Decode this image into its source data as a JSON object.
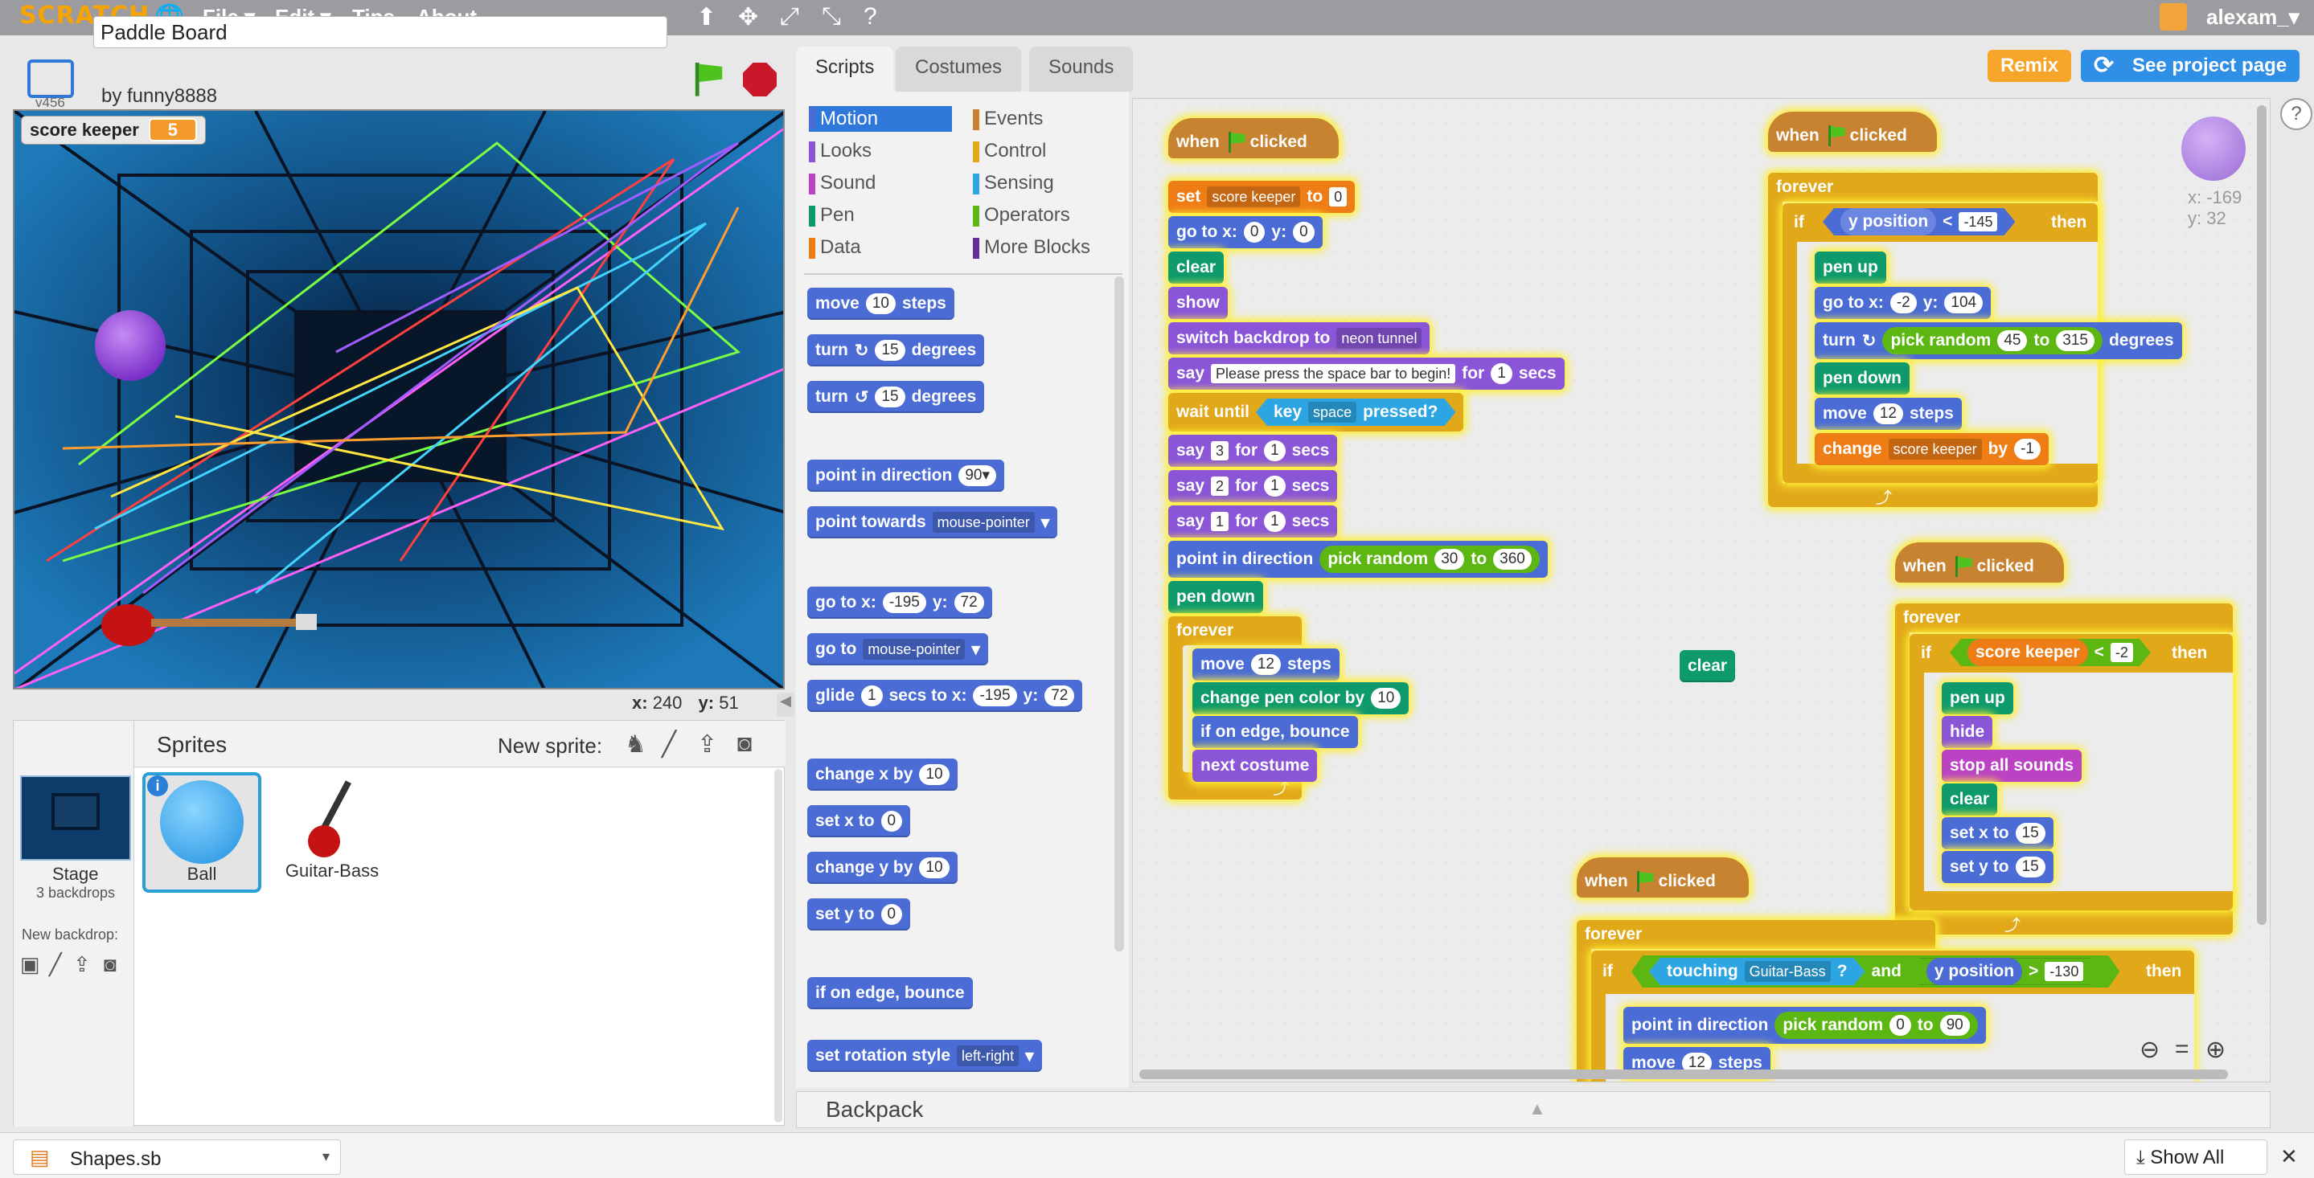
{
  "menu": {
    "logo": "SCRATCH",
    "file": "File ▾",
    "edit": "Edit ▾",
    "tips": "Tips",
    "about": "About",
    "user": "alexam_▾",
    "version": "v456"
  },
  "project": {
    "title": "Paddle Board",
    "author": "by funny8888"
  },
  "stage": {
    "monitor_label": "score keeper",
    "monitor_value": "5",
    "x_label": "x:",
    "x_value": "240",
    "y_label": "y:",
    "y_value": "51"
  },
  "sprites": {
    "heading": "Sprites",
    "new_sprite": "New sprite:",
    "stage_label": "Stage",
    "backdrops": "3 backdrops",
    "new_backdrop": "New backdrop:",
    "items": [
      "Ball",
      "Guitar-Bass"
    ]
  },
  "tabs": [
    "Scripts",
    "Costumes",
    "Sounds"
  ],
  "buttons": {
    "remix": "Remix",
    "see_project": "See project page",
    "show_all": "Show All",
    "help": "?"
  },
  "categories": [
    {
      "label": "Motion",
      "color": "#4a6cd4"
    },
    {
      "label": "Events",
      "color": "#c88330"
    },
    {
      "label": "Looks",
      "color": "#8a55d7"
    },
    {
      "label": "Control",
      "color": "#e1a91a"
    },
    {
      "label": "Sound",
      "color": "#bb42c3"
    },
    {
      "label": "Sensing",
      "color": "#2ca5e2"
    },
    {
      "label": "Pen",
      "color": "#0e9a6c"
    },
    {
      "label": "Operators",
      "color": "#5cb712"
    },
    {
      "label": "Data",
      "color": "#ee7d16"
    },
    {
      "label": "More Blocks",
      "color": "#632d99"
    }
  ],
  "palette": {
    "move": "move",
    "steps": "steps",
    "move_val": "10",
    "turn": "turn",
    "degrees": "degrees",
    "turn_val": "15",
    "point_dir": "point in direction",
    "point_dir_val": "90▾",
    "point_towards": "point towards",
    "mouse_pointer": "mouse-pointer",
    "goto_xy": "go to x:",
    "y": "y:",
    "goto_x": "-195",
    "goto_y": "72",
    "goto": "go to",
    "glide": "glide",
    "secs_to_x": "secs to x:",
    "glide_secs": "1",
    "change_x": "change x by",
    "set_x": "set x to",
    "change_y": "change y by",
    "set_y": "set y to",
    "ten": "10",
    "zero": "0",
    "edge_bounce": "if on edge, bounce",
    "rotation": "set rotation style",
    "rotation_val": "left-right"
  },
  "script1": {
    "when": "when",
    "clicked": "clicked",
    "set": "set",
    "var": "score keeper",
    "to": "to",
    "zero": "0",
    "goto": "go to x:",
    "y": "y:",
    "clear": "clear",
    "show": "show",
    "switch": "switch backdrop to",
    "backdrop": "neon tunnel",
    "say": "say",
    "say_msg": "Please press the space bar to begin!",
    "for": "for",
    "secs": "secs",
    "one": "1",
    "wait": "wait until",
    "key": "key",
    "space": "space",
    "pressed": "pressed?",
    "three": "3",
    "two": "2",
    "point_dir": "point in direction",
    "pick_random": "pick random",
    "r1": "30",
    "r2": "360",
    "pen_down": "pen down",
    "forever": "forever",
    "move": "move",
    "twelve": "12",
    "steps": "steps",
    "change_pen": "change pen color by",
    "ten": "10",
    "edge": "if on edge, bounce",
    "next": "next costume"
  },
  "script2": {
    "if": "if",
    "ypos": "y position",
    "lt": "<",
    "val": "-145",
    "then": "then",
    "pen_up": "pen up",
    "x": "-2",
    "y": "104",
    "turn": "turn",
    "r1": "45",
    "r2": "315",
    "degrees": "degrees",
    "change": "change",
    "by": "by",
    "neg1": "-1"
  },
  "script3": {
    "neg2": "-2",
    "hide": "hide",
    "stop": "stop all sounds",
    "set_x": "set x to",
    "set_y": "set y to",
    "fifteen": "15"
  },
  "script4": {
    "touching": "touching",
    "sprite": "Guitar-Bass",
    "q": "?",
    "and": "and",
    "gt": ">",
    "val": "-130",
    "r1": "0",
    "r2": "90"
  },
  "loose_clear": "clear",
  "sprite_info": {
    "x": "x: -169",
    "y": "y: 32"
  },
  "backpack": "Backpack",
  "download": {
    "file": "Shapes.sb"
  }
}
